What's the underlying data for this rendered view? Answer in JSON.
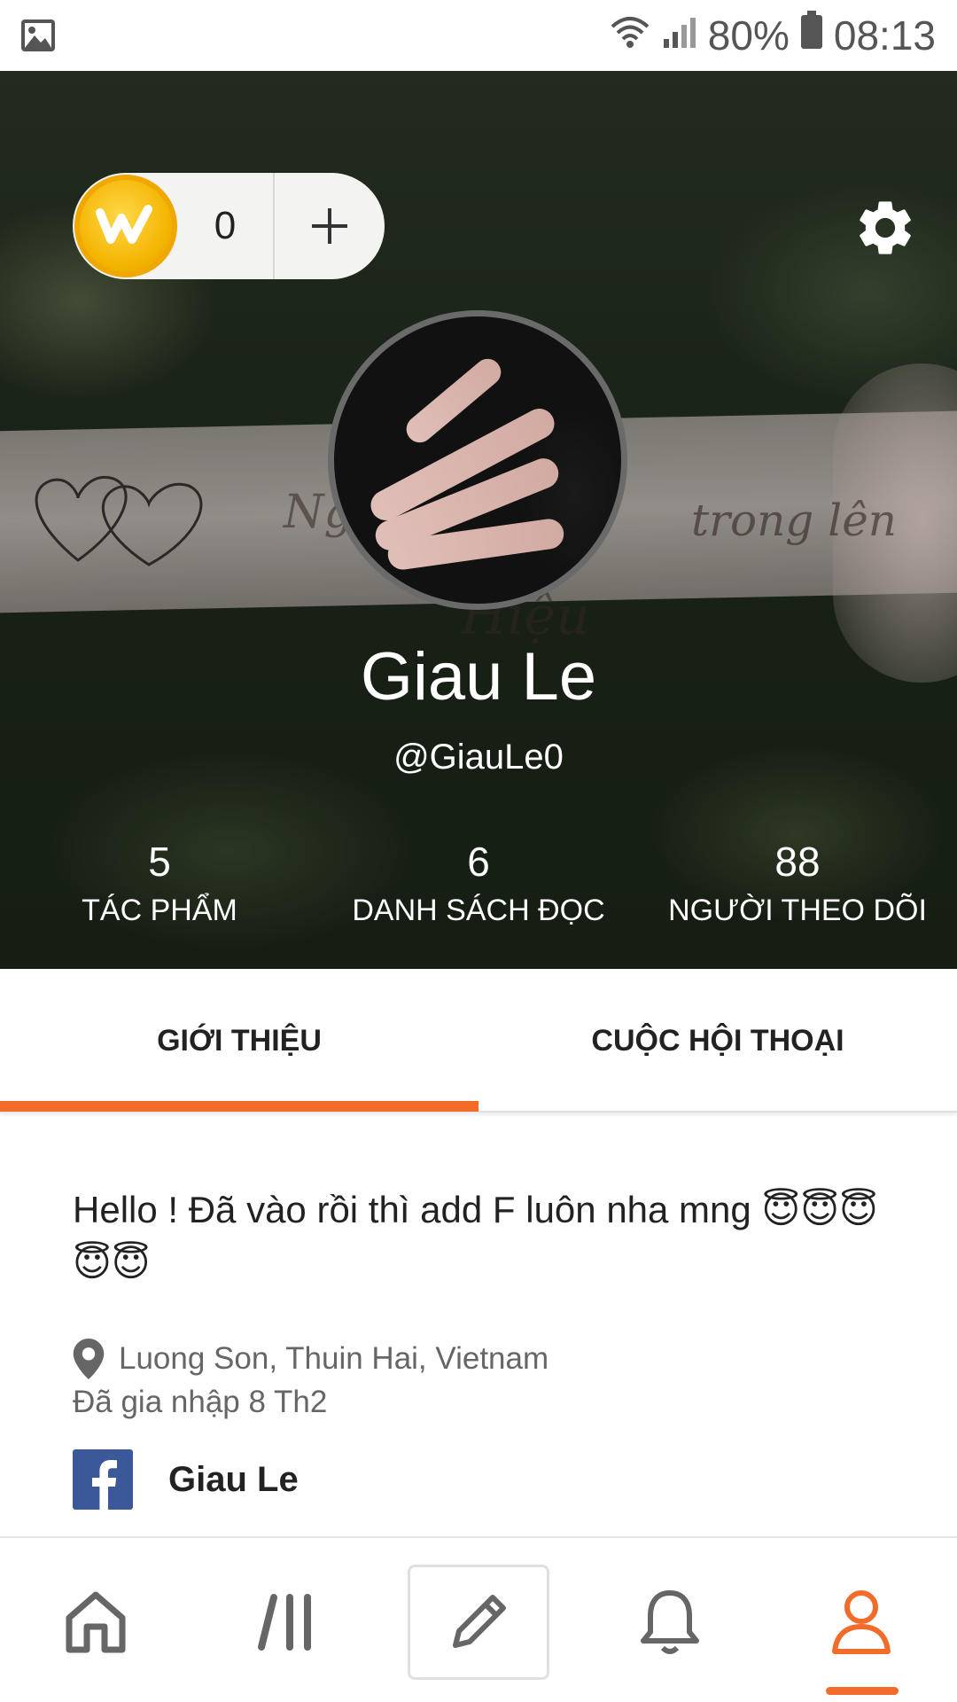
{
  "status_bar": {
    "battery": "80%",
    "time": "08:13"
  },
  "wallet": {
    "coin_count": "0",
    "icon": "wattpad-coin-icon"
  },
  "profile": {
    "display_name": "Giau Le",
    "username": "@GiauLe0",
    "cover_text": [
      "Ng",
      "trong lên",
      "Hiệu"
    ]
  },
  "stats": [
    {
      "value": "5",
      "label": "TÁC PHẨM"
    },
    {
      "value": "6",
      "label": "DANH SÁCH ĐỌC"
    },
    {
      "value": "88",
      "label": "NGƯỜI THEO DÕI"
    }
  ],
  "tabs": [
    {
      "label": "GIỚI THIỆU",
      "active": true
    },
    {
      "label": "CUỘC HỘI THOẠI",
      "active": false
    }
  ],
  "about": {
    "bio": "Hello ! Đã vào rồi thì add F luôn nha mng 😇😇😇😇😇",
    "location": "Luong Son, Thuin Hai, Vietnam",
    "joined": "Đã gia nhập 8 Th2",
    "facebook_name": "Giau Le"
  },
  "bottom_nav": [
    {
      "icon": "home-icon"
    },
    {
      "icon": "library-icon"
    },
    {
      "icon": "pencil-icon"
    },
    {
      "icon": "bell-icon"
    },
    {
      "icon": "profile-icon",
      "active": true
    }
  ],
  "colors": {
    "accent": "#f26b2a",
    "facebook": "#3b5998",
    "coin": "#f4b400"
  }
}
